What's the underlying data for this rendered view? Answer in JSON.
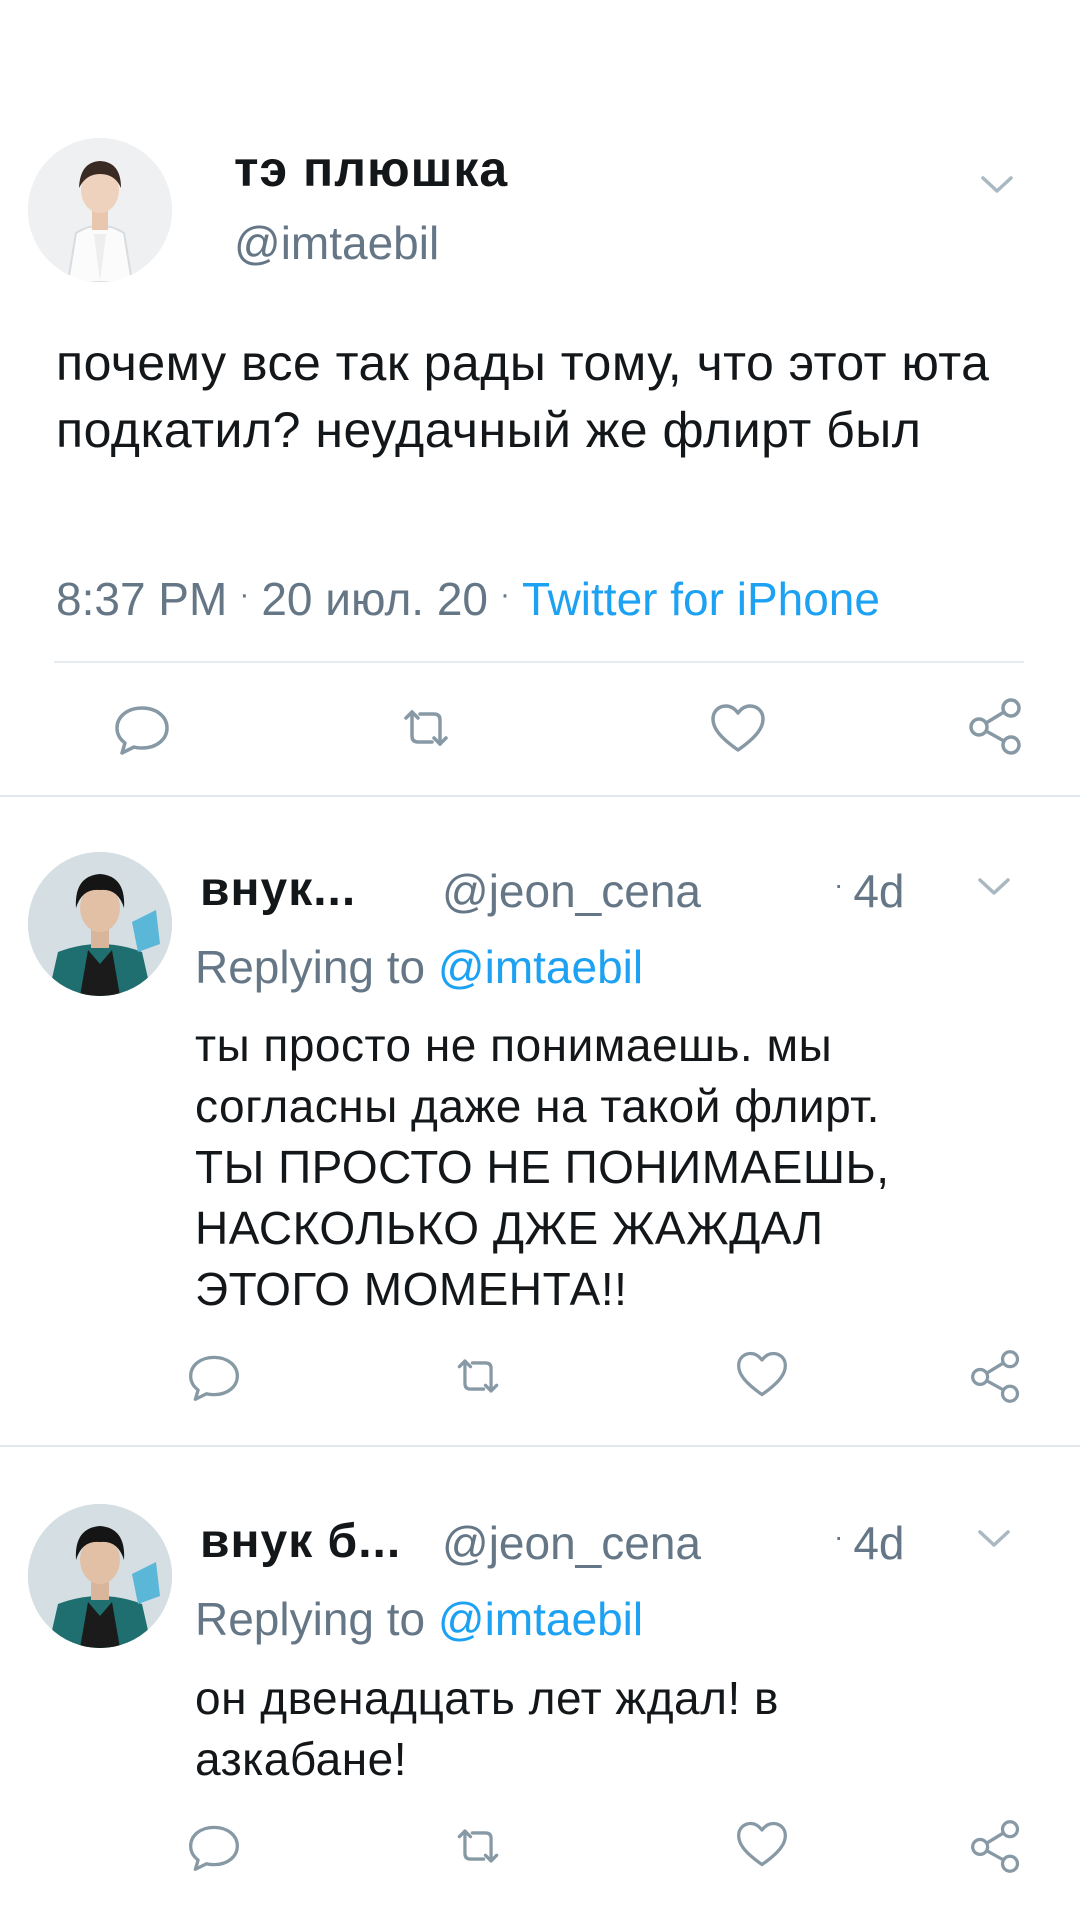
{
  "main_tweet": {
    "display_name": "тэ плюшка",
    "handle": "@imtaebil",
    "text": "почему все так рады тому, что этот юта подкатил? неудачный же флирт был",
    "time": "8:37 PM",
    "date": "20 июл. 20",
    "source": "Twitter for iPhone",
    "icons": [
      "reply-icon",
      "retweet-icon",
      "like-icon",
      "share-icon"
    ]
  },
  "replies": [
    {
      "display_name": "внук...",
      "handle": "@jeon_cena",
      "time": "4d",
      "replying_prefix": "Replying to",
      "replying_to": "@imtaebil",
      "text_lines": [
        "ты просто не понимаешь. мы",
        "согласны даже на такой флирт.",
        "ТЫ ПРОСТО НЕ ПОНИМАЕШЬ,",
        "НАСКОЛЬКО ДЖЕ ЖАЖДАЛ",
        "ЭТОГО МОМЕНТА!!"
      ]
    },
    {
      "display_name": "внук б...",
      "handle": "@jeon_cena",
      "time": "4d",
      "replying_prefix": "Replying to",
      "replying_to": "@imtaebil",
      "text_lines": [
        "он двенадцать лет ждал! в",
        "азкабане!"
      ]
    }
  ],
  "colors": {
    "text": "#14171a",
    "secondary": "#657786",
    "link": "#1da1f2",
    "divider": "#e1e8ed"
  }
}
